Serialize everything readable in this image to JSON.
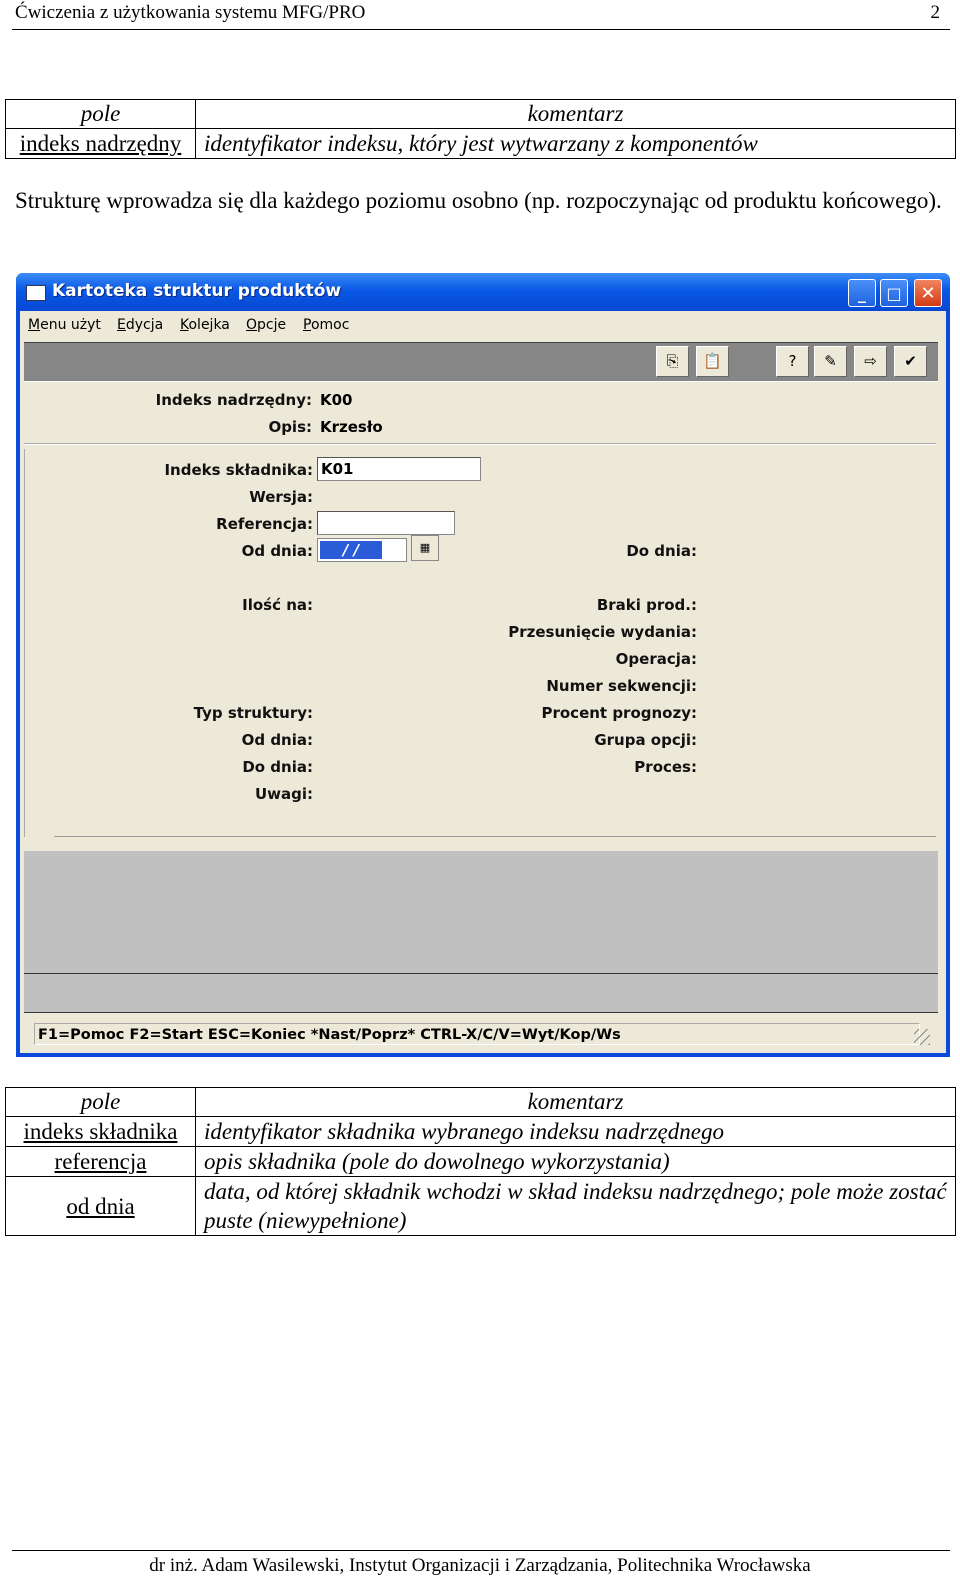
{
  "header": {
    "title": "Ćwiczenia z użytkowania systemu MFG/PRO",
    "page": "2"
  },
  "table1": {
    "col_field": "pole",
    "col_comment": "komentarz",
    "rows": [
      {
        "field": "indeks nadrzędny",
        "comment": "identyfikator indeksu, który jest wytwarzany z komponentów"
      }
    ]
  },
  "paragraph": "Strukturę wprowadza się dla każdego poziomu osobno (np. rozpoczynając od produktu końcowego).",
  "window": {
    "title": "Kartoteka struktur produktów",
    "buttons": {
      "minimize": "_",
      "maximize": "□",
      "close": "✕"
    },
    "menu": [
      "Menu użyt",
      "Edycja",
      "Kolejka",
      "Opcje",
      "Pomoc"
    ],
    "toolbar_icons": [
      "copy-icon",
      "paste-icon",
      "help-query-icon",
      "edit-help-icon",
      "export-icon",
      "edit-check-icon"
    ],
    "header_section": {
      "parent_label": "Indeks nadrzędny:",
      "parent_value": "K00",
      "desc_label": "Opis:",
      "desc_value": "Krzesło"
    },
    "form": {
      "component_label": "Indeks składnika:",
      "component_value": "K01",
      "version_label": "Wersja:",
      "reference_label": "Referencja:",
      "reference_value": "",
      "from_date_label": "Od dnia:",
      "from_date_value": "/ /",
      "to_date_label": "Do dnia:",
      "qty_label": "Ilość na:",
      "scrap_label": "Braki prod.:",
      "offset_label": "Przesunięcie wydania:",
      "operation_label": "Operacja:",
      "sequence_label": "Numer sekwencji:",
      "forecast_label": "Procent prognozy:",
      "option_group_label": "Grupa opcji:",
      "process_label": "Proces:",
      "structure_type_label": "Typ struktury:",
      "from_date2_label": "Od dnia:",
      "to_date2_label": "Do dnia:",
      "notes_label": "Uwagi:"
    },
    "status": "F1=Pomoc F2=Start ESC=Koniec *Nast/Poprz* CTRL-X/C/V=Wyt/Kop/Ws"
  },
  "table2": {
    "col_field": "pole",
    "col_comment": "komentarz",
    "rows": [
      {
        "field": "indeks składnika",
        "comment": "identyfikator składnika wybranego indeksu nadrzędnego"
      },
      {
        "field": "referencja",
        "comment": "opis składnika (pole do dowolnego wykorzystania)"
      },
      {
        "field": "od dnia",
        "comment": "data, od której składnik wchodzi  w skład indeksu nadrzędnego; pole może zostać puste (niewypełnione)"
      }
    ]
  },
  "footer": "dr inż. Adam Wasilewski, Instytut Organizacji i Zarządzania, Politechnika Wrocławska"
}
